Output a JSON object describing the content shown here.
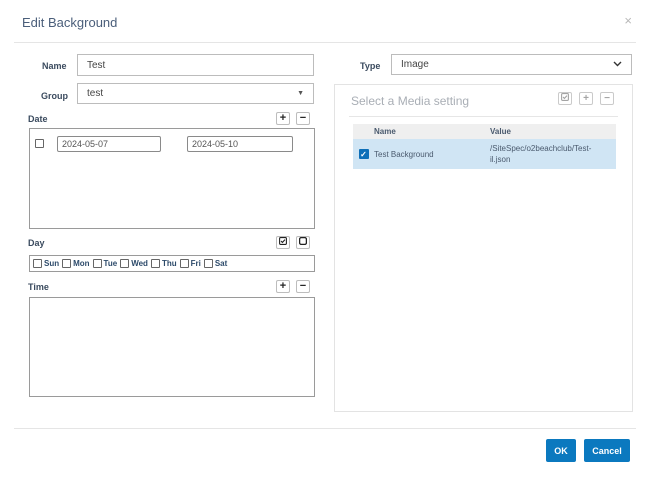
{
  "dialog": {
    "title": "Edit Background",
    "close_glyph": "×"
  },
  "form": {
    "name_label": "Name",
    "name_value": "Test",
    "group_label": "Group",
    "group_value": "test",
    "type_label": "Type",
    "type_value": "Image"
  },
  "date": {
    "label": "Date",
    "start": "2024-05-07",
    "end": "2024-05-10",
    "add_glyph": "+",
    "remove_glyph": "−"
  },
  "day": {
    "label": "Day",
    "days": [
      "Sun",
      "Mon",
      "Tue",
      "Wed",
      "Thu",
      "Fri",
      "Sat"
    ]
  },
  "time": {
    "label": "Time",
    "add_glyph": "+",
    "remove_glyph": "−"
  },
  "media": {
    "title": "Select a Media setting",
    "columns": {
      "name": "Name",
      "value": "Value"
    },
    "rows": [
      {
        "name": "Test Background",
        "value": "/SiteSpec/o2beachclub/Test-il.json",
        "checked": true
      }
    ]
  },
  "footer": {
    "ok_label": "OK",
    "cancel_label": "Cancel"
  },
  "colors": {
    "accent": "#0b79bf",
    "selected_row": "#d0e5f4",
    "title_text": "#4a5e7a"
  }
}
